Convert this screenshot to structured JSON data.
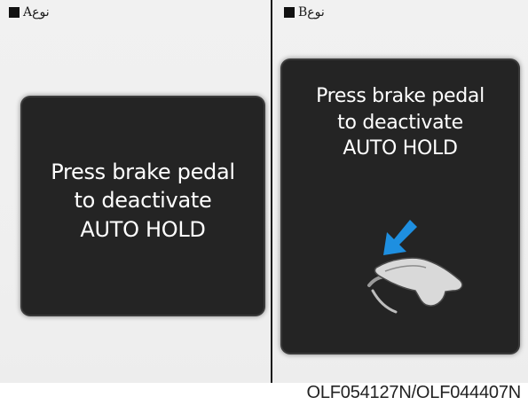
{
  "panels": {
    "a": {
      "type_label": "نوع",
      "type_letter": "A",
      "message": [
        "Press brake pedal",
        "to deactivate",
        "AUTO HOLD"
      ]
    },
    "b": {
      "type_label": "نوع",
      "type_letter": "B",
      "message": [
        "Press brake pedal",
        "to deactivate",
        "AUTO HOLD"
      ],
      "icon": "brake-pedal-icon"
    }
  },
  "caption": "OLF054127N/OLF044407N",
  "colors": {
    "screen_bg": "#242424",
    "screen_text": "#ffffff",
    "arrow": "#1e8fe0",
    "pedal": "#d9d9d9"
  }
}
